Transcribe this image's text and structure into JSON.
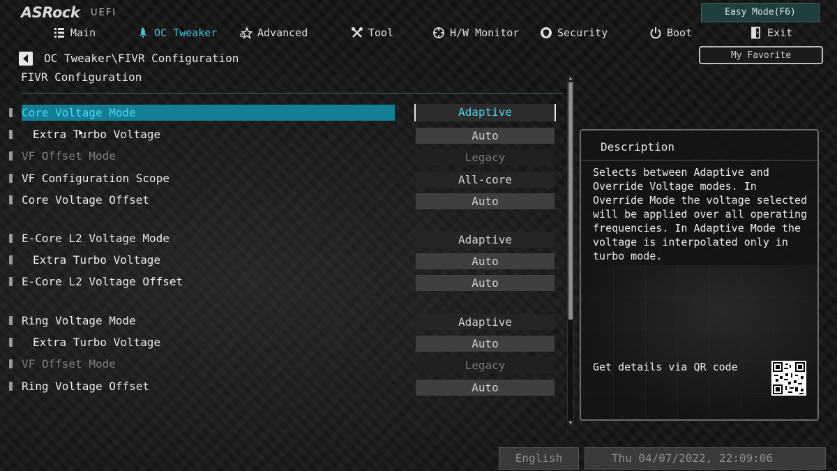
{
  "brand": {
    "logo": "ASRock",
    "subtitle": "UEFI"
  },
  "easy_mode_button": "Easy Mode(F6)",
  "nav": [
    {
      "label": "Main",
      "icon": "list-icon"
    },
    {
      "label": "OC Tweaker",
      "icon": "rocket-icon",
      "active": true
    },
    {
      "label": "Advanced",
      "icon": "star-icon"
    },
    {
      "label": "Tool",
      "icon": "tools-icon"
    },
    {
      "label": "H/W Monitor",
      "icon": "crosshair-icon"
    },
    {
      "label": "Security",
      "icon": "shield-icon"
    },
    {
      "label": "Boot",
      "icon": "power-icon"
    },
    {
      "label": "Exit",
      "icon": "exit-icon"
    }
  ],
  "breadcrumb": "OC Tweaker\\FIVR Configuration",
  "section_title": "FIVR Configuration",
  "my_favorite_button": "My Favorite",
  "rows": [
    {
      "label": "Core Voltage Mode",
      "value": "Adaptive",
      "state": "selected",
      "indent": false
    },
    {
      "label": "Extra Turbo Voltage",
      "value": "Auto",
      "state": "normal",
      "indent": true
    },
    {
      "label": "VF Offset Mode",
      "value": "Legacy",
      "state": "disabled",
      "indent": false
    },
    {
      "label": "VF Configuration Scope",
      "value": "All-core",
      "state": "normal",
      "indent": false
    },
    {
      "label": "Core Voltage Offset",
      "value": "Auto",
      "state": "normal",
      "indent": false
    },
    {
      "label": "E-Core L2 Voltage Mode",
      "value": "Adaptive",
      "state": "normal",
      "indent": false
    },
    {
      "label": "Extra Turbo Voltage",
      "value": "Auto",
      "state": "normal",
      "indent": true
    },
    {
      "label": "E-Core L2 Voltage Offset",
      "value": "Auto",
      "state": "normal",
      "indent": false
    },
    {
      "label": "Ring Voltage Mode",
      "value": "Adaptive",
      "state": "normal",
      "indent": false
    },
    {
      "label": "Extra Turbo Voltage",
      "value": "Auto",
      "state": "normal",
      "indent": true
    },
    {
      "label": "VF Offset Mode",
      "value": "Legacy",
      "state": "disabled",
      "indent": false
    },
    {
      "label": "Ring Voltage Offset",
      "value": "Auto",
      "state": "normal",
      "indent": false
    }
  ],
  "description": {
    "title": "Description",
    "text": "Selects between Adaptive and Override Voltage modes. In Override Mode the voltage selected will be applied over all operating frequencies. In Adaptive Mode the voltage is interpolated only in turbo mode.",
    "qr_text": "Get details via QR code"
  },
  "footer": {
    "language": "English",
    "datetime": "Thu 04/07/2022, 22:09:06"
  },
  "colors": {
    "accent": "#3cc3e0",
    "selected_bg": "#137f96"
  }
}
